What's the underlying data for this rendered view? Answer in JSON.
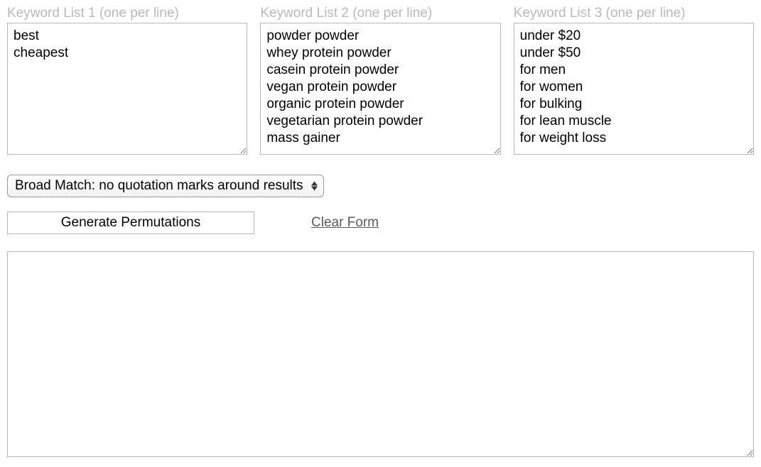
{
  "lists": {
    "list1": {
      "label": "Keyword List 1 (one per line)",
      "value": "best\ncheapest"
    },
    "list2": {
      "label": "Keyword List 2 (one per line)",
      "value": "powder powder\nwhey protein powder\ncasein protein powder\nvegan protein powder\norganic protein powder\nvegetarian protein powder\nmass gainer"
    },
    "list3": {
      "label": "Keyword List 3 (one per line)",
      "value": "under $20\nunder $50\nfor men\nfor women\nfor bulking\nfor lean muscle\nfor weight loss"
    }
  },
  "match_select": {
    "selected": "Broad Match: no quotation marks around results"
  },
  "actions": {
    "generate_label": "Generate Permutations",
    "clear_label": "Clear Form"
  },
  "results": {
    "value": ""
  }
}
